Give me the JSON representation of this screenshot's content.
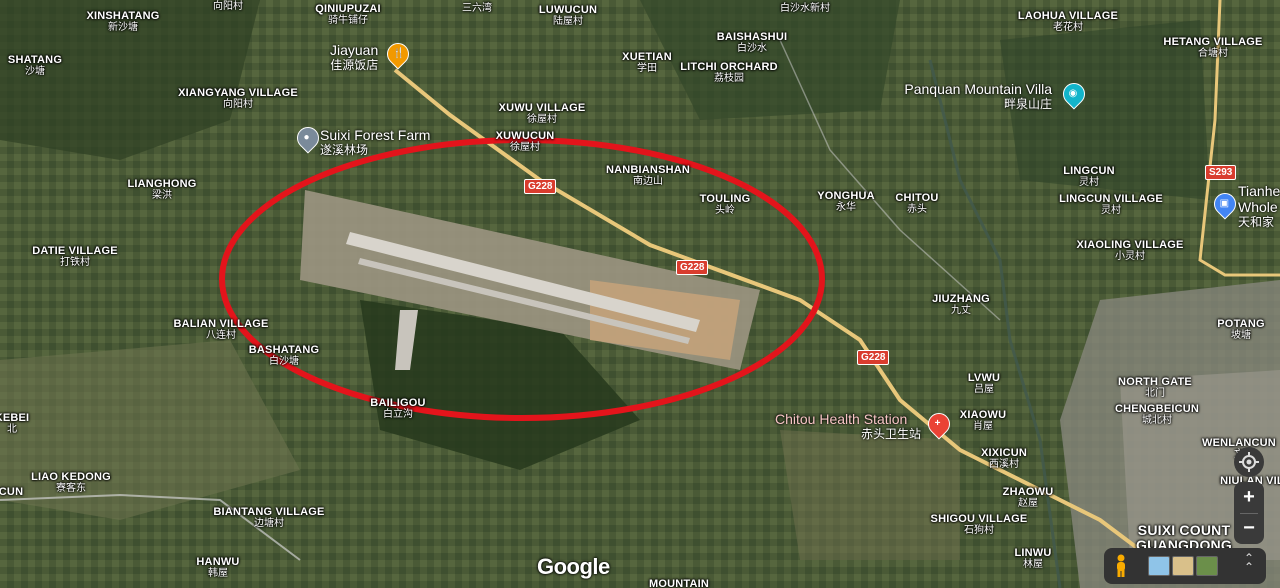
{
  "map": {
    "places": [
      {
        "id": "xinshatang",
        "en": "XINSHATANG",
        "cn": "新沙塘"
      },
      {
        "id": "xiangyang",
        "en": "",
        "cn": "向阳村"
      },
      {
        "id": "qiniupuzai",
        "en": "QINIUPUZAI",
        "cn": "骑牛铺仔"
      },
      {
        "id": "sanliuwan",
        "en": "",
        "cn": "三六湾"
      },
      {
        "id": "luwucun",
        "en": "LUWUCUN",
        "cn": "陆屋村"
      },
      {
        "id": "baishaxincun",
        "en": "",
        "cn": "白沙水新村"
      },
      {
        "id": "laohua",
        "en": "LAOHUA VILLAGE",
        "cn": "老花村"
      },
      {
        "id": "shatang",
        "en": "SHATANG",
        "cn": "沙塘"
      },
      {
        "id": "xuetian",
        "en": "XUETIAN",
        "cn": "学田"
      },
      {
        "id": "baishashui",
        "en": "BAISHASHUI",
        "cn": "白沙水"
      },
      {
        "id": "hetang",
        "en": "HETANG VILLAGE",
        "cn": "合塘村"
      },
      {
        "id": "litchi",
        "en": "LITCHI ORCHARD",
        "cn": "荔枝园"
      },
      {
        "id": "xiangyang_v",
        "en": "XIANGYANG VILLAGE",
        "cn": "向阳村"
      },
      {
        "id": "xuwu",
        "en": "XUWU VILLAGE",
        "cn": "徐屋村"
      },
      {
        "id": "xuwucun",
        "en": "XUWUCUN",
        "cn": "徐屋村"
      },
      {
        "id": "lianghong",
        "en": "LIANGHONG",
        "cn": "梁洪"
      },
      {
        "id": "nanbianshan",
        "en": "NANBIANSHAN",
        "cn": "南边山"
      },
      {
        "id": "lingcun",
        "en": "LINGCUN",
        "cn": "灵村"
      },
      {
        "id": "touling",
        "en": "TOULING",
        "cn": "头岭"
      },
      {
        "id": "yonghua",
        "en": "YONGHUA",
        "cn": "永华"
      },
      {
        "id": "chitou",
        "en": "CHITOU",
        "cn": "赤头"
      },
      {
        "id": "lingcun_v",
        "en": "LINGCUN VILLAGE",
        "cn": "灵村"
      },
      {
        "id": "datie",
        "en": "DATIE VILLAGE",
        "cn": "打铁村"
      },
      {
        "id": "xiaoling",
        "en": "XIAOLING VILLAGE",
        "cn": "小灵村"
      },
      {
        "id": "jiuzhang",
        "en": "JIUZHANG",
        "cn": "九丈"
      },
      {
        "id": "balian",
        "en": "BALIAN VILLAGE",
        "cn": "八连村"
      },
      {
        "id": "potang",
        "en": "POTANG",
        "cn": "坡塘"
      },
      {
        "id": "bashatang",
        "en": "BASHATANG",
        "cn": "白沙塘"
      },
      {
        "id": "lvwu",
        "en": "LVWU",
        "cn": "吕屋"
      },
      {
        "id": "northgate",
        "en": "NORTH GATE",
        "cn": "北门"
      },
      {
        "id": "kebei",
        "en": "KEBEI",
        "cn": "北"
      },
      {
        "id": "bailigou",
        "en": "BAILIGOU",
        "cn": "白立沟"
      },
      {
        "id": "chengbeicun",
        "en": "CHENGBEICUN",
        "cn": "城北村"
      },
      {
        "id": "xiaowu",
        "en": "XIAOWU",
        "cn": "肖屋"
      },
      {
        "id": "wenlancun",
        "en": "WENLANCUN",
        "cn": "文"
      },
      {
        "id": "xixicun",
        "en": "XIXICUN",
        "cn": "西溪村"
      },
      {
        "id": "liaokedong",
        "en": "LIAO KEDONG",
        "cn": "寮客东"
      },
      {
        "id": "niulan",
        "en": "NIULAN VIL",
        "cn": ""
      },
      {
        "id": "cun",
        "en": "CUN",
        "cn": ""
      },
      {
        "id": "zhaowu",
        "en": "ZHAOWU",
        "cn": "赵屋"
      },
      {
        "id": "biantang",
        "en": "BIANTANG VILLAGE",
        "cn": "边塘村"
      },
      {
        "id": "shigou",
        "en": "SHIGOU VILLAGE",
        "cn": "石狗村"
      },
      {
        "id": "hanwu",
        "en": "HANWU",
        "cn": "韩屋"
      },
      {
        "id": "linwu",
        "en": "LINWU",
        "cn": "林屋"
      },
      {
        "id": "suixi",
        "en": "SUIXI COUNT GUANGDONG",
        "cn": ""
      },
      {
        "id": "mountain",
        "en": "MOUNTAIN",
        "cn": ""
      }
    ],
    "pois": [
      {
        "id": "jiayuan",
        "en": "Jiayuan",
        "cn": "佳源饭店",
        "icon": "restaurant-icon",
        "color": "#f29900"
      },
      {
        "id": "suixi-forest",
        "en": "Suixi Forest Farm",
        "cn": "遂溪林场",
        "icon": "location-pin-icon",
        "color": "#7a8a9a"
      },
      {
        "id": "panquan",
        "en": "Panquan Mountain Villa",
        "cn": "畔泉山庄",
        "icon": "camera-icon",
        "color": "#12b5cb"
      },
      {
        "id": "tianhe",
        "en": "Tianhe Whole",
        "cn": "天和家",
        "icon": "shopping-icon",
        "color": "#4285f4"
      },
      {
        "id": "chitou-health",
        "en": "Chitou Health Station",
        "cn": "赤头卫生站",
        "icon": "hospital-icon",
        "color": "#ea4335"
      }
    ],
    "roads": [
      {
        "id": "g228a",
        "label": "G228"
      },
      {
        "id": "g228b",
        "label": "G228"
      },
      {
        "id": "g228c",
        "label": "G228"
      },
      {
        "id": "s293",
        "label": "S293"
      }
    ],
    "highlight_color": "#e3141b"
  },
  "attribution": {
    "logo_text": "Google"
  },
  "controls": {
    "zoom_in": "+",
    "zoom_out": "−",
    "expand": "⌃⌃"
  }
}
